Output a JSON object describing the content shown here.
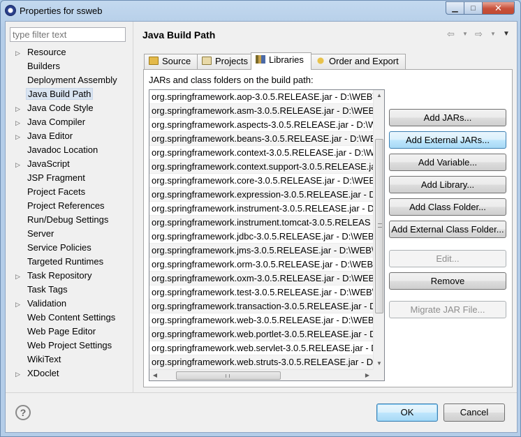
{
  "window": {
    "title": "Properties for ssweb",
    "min_glyph": "▁",
    "max_glyph": "□",
    "close_glyph": "✕"
  },
  "filter": {
    "placeholder": "type filter text",
    "value": ""
  },
  "nav": {
    "items": [
      {
        "label": "Resource",
        "expandable": true
      },
      {
        "label": "Builders",
        "expandable": false
      },
      {
        "label": "Deployment Assembly",
        "expandable": false
      },
      {
        "label": "Java Build Path",
        "expandable": false,
        "selected": true
      },
      {
        "label": "Java Code Style",
        "expandable": true
      },
      {
        "label": "Java Compiler",
        "expandable": true
      },
      {
        "label": "Java Editor",
        "expandable": true
      },
      {
        "label": "Javadoc Location",
        "expandable": false
      },
      {
        "label": "JavaScript",
        "expandable": true
      },
      {
        "label": "JSP Fragment",
        "expandable": false
      },
      {
        "label": "Project Facets",
        "expandable": false
      },
      {
        "label": "Project References",
        "expandable": false
      },
      {
        "label": "Run/Debug Settings",
        "expandable": false
      },
      {
        "label": "Server",
        "expandable": false
      },
      {
        "label": "Service Policies",
        "expandable": false
      },
      {
        "label": "Targeted Runtimes",
        "expandable": false
      },
      {
        "label": "Task Repository",
        "expandable": true
      },
      {
        "label": "Task Tags",
        "expandable": false
      },
      {
        "label": "Validation",
        "expandable": true
      },
      {
        "label": "Web Content Settings",
        "expandable": false
      },
      {
        "label": "Web Page Editor",
        "expandable": false
      },
      {
        "label": "Web Project Settings",
        "expandable": false
      },
      {
        "label": "WikiText",
        "expandable": false
      },
      {
        "label": "XDoclet",
        "expandable": true
      }
    ]
  },
  "page": {
    "title": "Java Build Path",
    "tabs": [
      {
        "label": "Source",
        "active": false
      },
      {
        "label": "Projects",
        "active": false
      },
      {
        "label": "Libraries",
        "active": true
      },
      {
        "label": "Order and Export",
        "active": false
      }
    ],
    "list_label": "JARs and class folders on the build path:",
    "jars": [
      "org.springframework.aop-3.0.5.RELEASE.jar - D:\\WEB\\",
      "org.springframework.asm-3.0.5.RELEASE.jar - D:\\WEB\\",
      "org.springframework.aspects-3.0.5.RELEASE.jar - D:\\W",
      "org.springframework.beans-3.0.5.RELEASE.jar - D:\\WE",
      "org.springframework.context-3.0.5.RELEASE.jar - D:\\W",
      "org.springframework.context.support-3.0.5.RELEASE.ja",
      "org.springframework.core-3.0.5.RELEASE.jar - D:\\WEB",
      "org.springframework.expression-3.0.5.RELEASE.jar - D",
      "org.springframework.instrument-3.0.5.RELEASE.jar - D:",
      "org.springframework.instrument.tomcat-3.0.5.RELEAS",
      "org.springframework.jdbc-3.0.5.RELEASE.jar - D:\\WEB\\",
      "org.springframework.jms-3.0.5.RELEASE.jar - D:\\WEB\\s",
      "org.springframework.orm-3.0.5.RELEASE.jar - D:\\WEB\\",
      "org.springframework.oxm-3.0.5.RELEASE.jar - D:\\WEB\\",
      "org.springframework.test-3.0.5.RELEASE.jar - D:\\WEB\\",
      "org.springframework.transaction-3.0.5.RELEASE.jar - D",
      "org.springframework.web-3.0.5.RELEASE.jar - D:\\WEB\\",
      "org.springframework.web.portlet-3.0.5.RELEASE.jar - D",
      "org.springframework.web.servlet-3.0.5.RELEASE.jar - D",
      "org.springframework.web.struts-3.0.5.RELEASE.jar - D:"
    ],
    "buttons": {
      "add_jars": "Add JARs...",
      "add_external_jars": "Add External JARs...",
      "add_variable": "Add Variable...",
      "add_library": "Add Library...",
      "add_class_folder": "Add Class Folder...",
      "add_external_class_folder": "Add External Class Folder...",
      "edit": "Edit...",
      "remove": "Remove",
      "migrate_jar": "Migrate JAR File..."
    }
  },
  "footer": {
    "help_glyph": "?",
    "ok_label": "OK",
    "cancel_label": "Cancel"
  },
  "icons": {
    "back": "⇦",
    "forward": "⇨",
    "dropdown": "▼",
    "expand": "▷",
    "scroll_up": "▲",
    "scroll_down": "▼",
    "scroll_left": "◀",
    "scroll_right": "▶"
  }
}
